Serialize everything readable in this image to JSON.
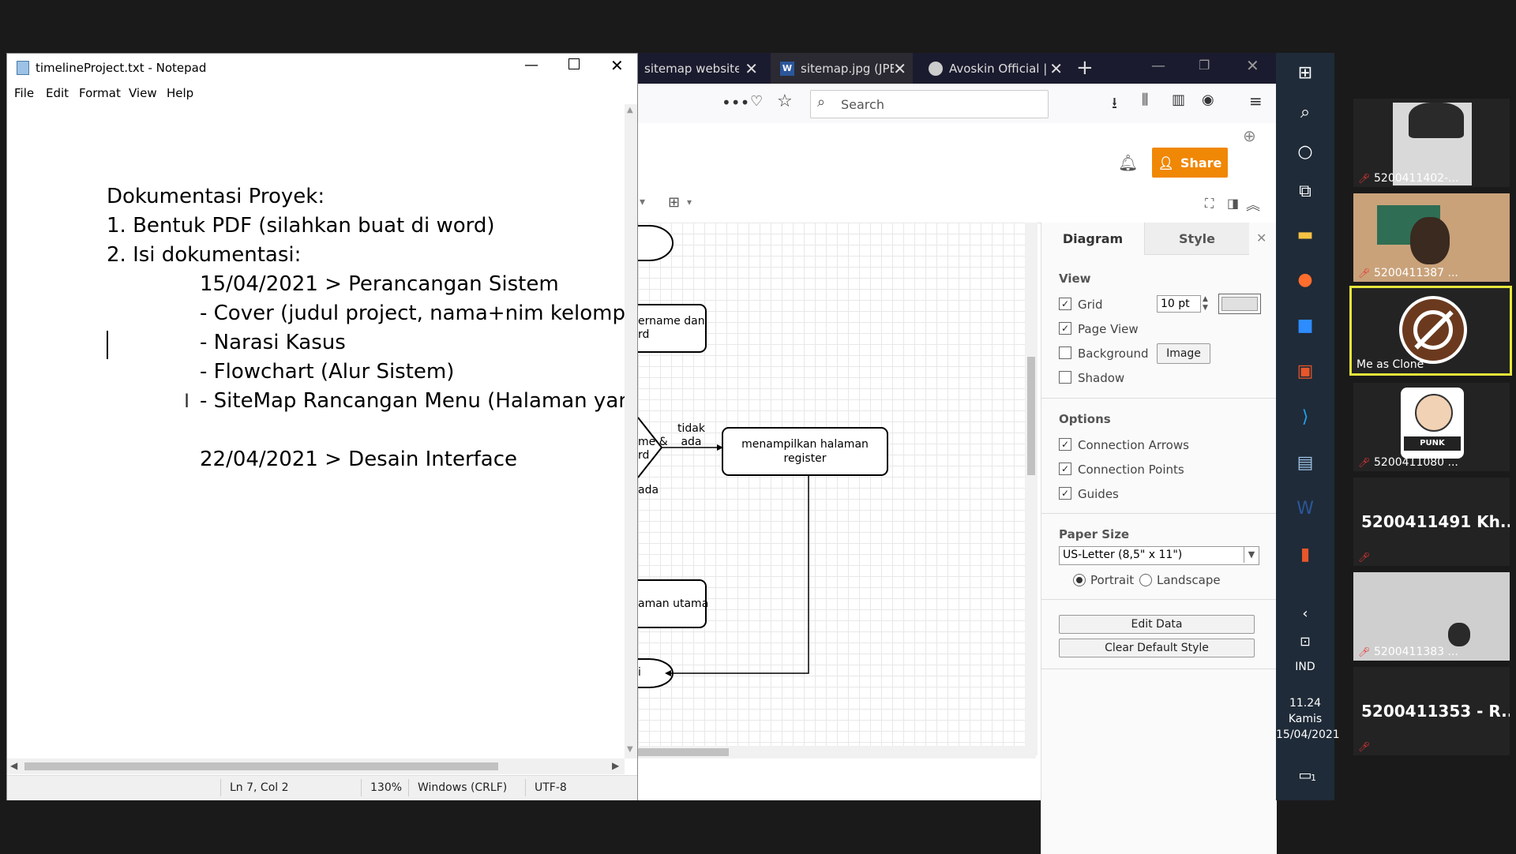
{
  "browser": {
    "tabs": [
      {
        "title": "sitemap website -",
        "active": false
      },
      {
        "title": "sitemap.jpg (JPEG",
        "active": true
      },
      {
        "title": "Avoskin Official | E",
        "active": false
      }
    ],
    "search_placeholder": "Search"
  },
  "drawio": {
    "share_label": "Share",
    "canvas_nodes": {
      "node1": "ername dan\nrd",
      "diamond_text": "me &\nrd",
      "edge_tidak_ada": "tidak\nada",
      "register_box": "menampilkan halaman\nregister",
      "edge_ada": "ada",
      "main_box": "aman utama",
      "end_text": "i"
    },
    "panel": {
      "tabs": [
        "Diagram",
        "Style"
      ],
      "view_label": "View",
      "grid_label": "Grid",
      "grid_size": "10 pt",
      "page_view_label": "Page View",
      "background_label": "Background",
      "image_btn": "Image",
      "shadow_label": "Shadow",
      "options_label": "Options",
      "connection_arrows": "Connection Arrows",
      "connection_points": "Connection Points",
      "guides": "Guides",
      "paper_size_label": "Paper Size",
      "paper_size_value": "US-Letter (8,5\" x 11\")",
      "portrait": "Portrait",
      "landscape": "Landscape",
      "edit_data": "Edit Data",
      "clear_default_style": "Clear Default Style"
    }
  },
  "notepad": {
    "title": "timelineProject.txt - Notepad",
    "menu": [
      "File",
      "Edit",
      "Format",
      "View",
      "Help"
    ],
    "lines": [
      "Dokumentasi Proyek:",
      "1. Bentuk PDF (silahkan buat di word)",
      "2. Isi dokumentasi:",
      "15/04/2021 > Perancangan Sistem",
      "- Cover (judul project, nama+nim kelompok)",
      "- Narasi Kasus",
      "- Flowchart (Alur Sistem)",
      "- SiteMap Rancangan Menu (Halaman yang a",
      "22/04/2021 > Desain Interface"
    ],
    "status": {
      "position": "Ln 7, Col 2",
      "zoom": "130%",
      "line_ending": "Windows (CRLF)",
      "encoding": "UTF-8"
    }
  },
  "taskbar": {
    "language": "IND",
    "time": "11.24",
    "day": "Kamis",
    "date": "15/04/2021",
    "notification_count": "1"
  },
  "participants": [
    {
      "name": "5200411402-...",
      "type": "video"
    },
    {
      "name": "5200411387 ...",
      "type": "video"
    },
    {
      "name": "Me as Clone",
      "type": "self"
    },
    {
      "name": "5200411080 ...",
      "type": "avatar"
    },
    {
      "name": "5200411491  Kh...",
      "type": "name"
    },
    {
      "name": "5200411383 ...",
      "type": "video"
    },
    {
      "name": "5200411353 - R...",
      "type": "name"
    }
  ]
}
